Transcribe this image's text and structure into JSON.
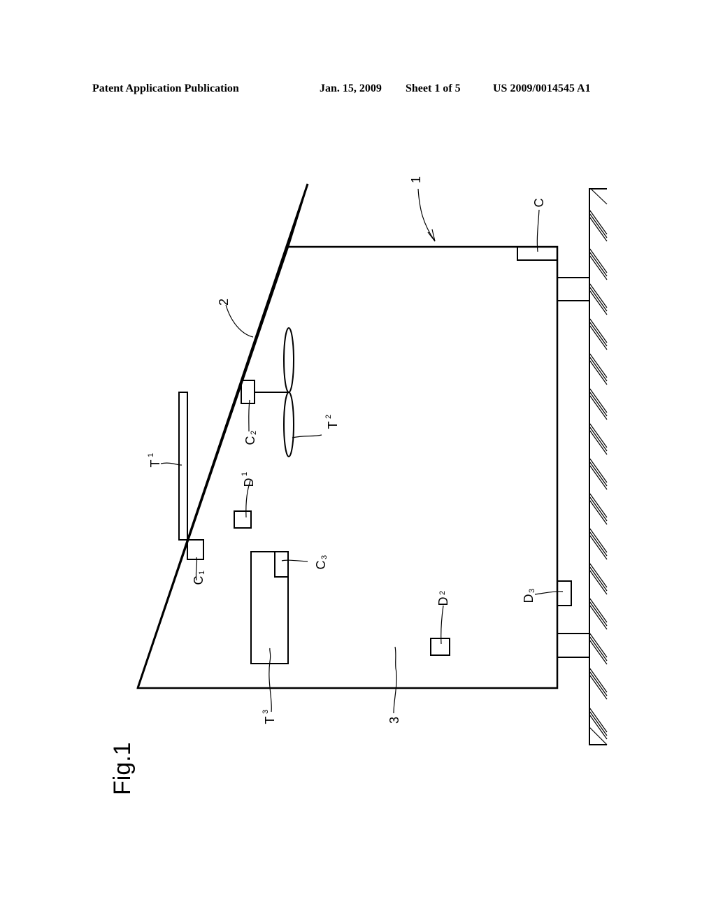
{
  "header": {
    "publication_type": "Patent Application Publication",
    "date": "Jan. 15, 2009",
    "sheet": "Sheet 1 of 5",
    "patent_number": "US 2009/0014545 A1"
  },
  "figure": {
    "label": "Fig.1",
    "reference_labels": {
      "building": "1",
      "roof": "2",
      "room": "3",
      "controller_main": "C",
      "controller_1": {
        "base": "C",
        "sub": "1"
      },
      "controller_2": {
        "base": "C",
        "sub": "2"
      },
      "controller_3": {
        "base": "C",
        "sub": "3"
      },
      "device_1": {
        "base": "D",
        "sub": "1"
      },
      "device_2": {
        "base": "D",
        "sub": "2"
      },
      "device_3": {
        "base": "D",
        "sub": "3"
      },
      "target_1": {
        "base": "T",
        "sub": "1"
      },
      "target_2": {
        "base": "T",
        "sub": "2"
      },
      "target_3": {
        "base": "T",
        "sub": "3"
      }
    }
  }
}
